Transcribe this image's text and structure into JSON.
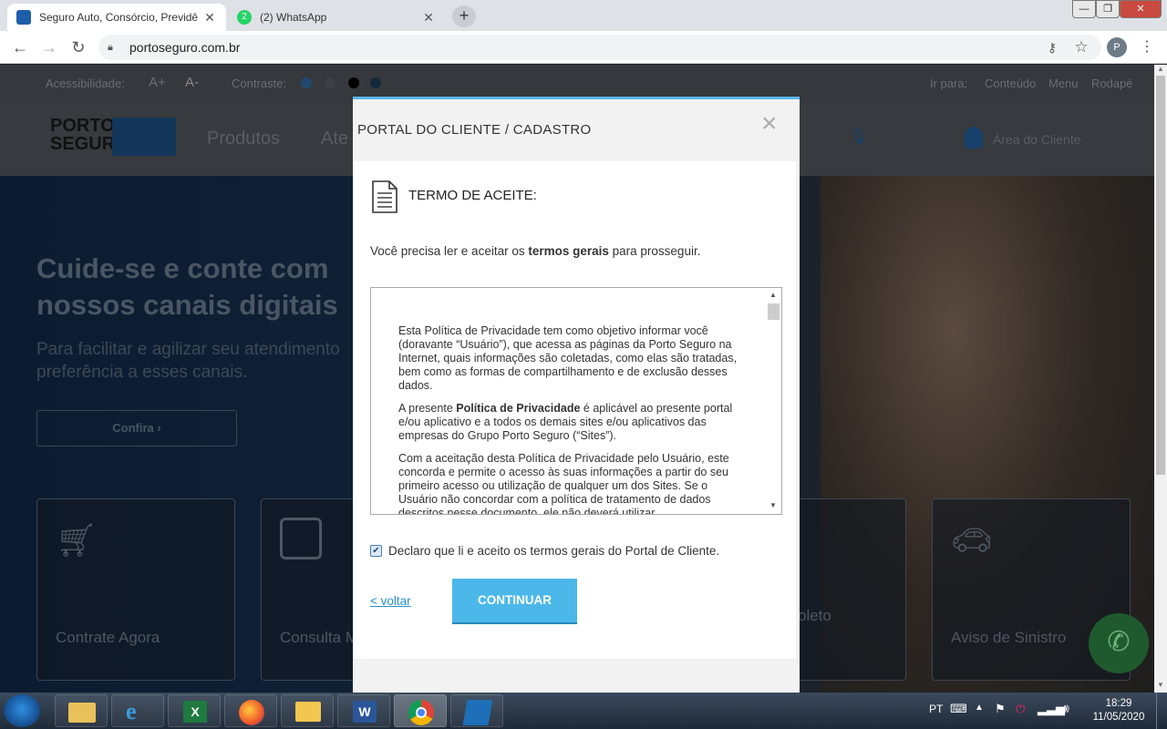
{
  "browser": {
    "tabs": [
      {
        "title": "Seguro Auto, Consórcio, Previdê",
        "favicon": "porto-seguro-favicon",
        "active": true
      },
      {
        "title": "(2) WhatsApp",
        "favicon": "whatsapp-favicon",
        "active": false
      }
    ],
    "url": "portoseguro.com.br",
    "profile_initial": "P"
  },
  "site": {
    "accessibility": {
      "label": "Acessibilidade:",
      "increase": "A+",
      "decrease": "A-",
      "contrast_label": "Contraste:",
      "jump_label": "Ir para:",
      "links": [
        "Conteúdo",
        "Menu",
        "Rodapé"
      ]
    },
    "logo_line1": "PORTO",
    "logo_line2": "SEGURO",
    "nav": [
      "Produtos",
      "Ate"
    ],
    "client_area": "Área do Cliente",
    "hero": {
      "title_line1": "Cuide-se e conte com",
      "title_line2": "nossos canais digitais",
      "sub_line1": "Para facilitar e agilizar seu atendimento",
      "sub_line2": "preferência a esses canais.",
      "cta": "Confira ›"
    },
    "cards": [
      "Contrate Agora",
      "Consulta M",
      "oleto",
      "Aviso de Sinistro"
    ]
  },
  "modal": {
    "title": "PORTAL DO CLIENTE / CADASTRO",
    "close": "×",
    "section_title": "TERMO DE ACEITE:",
    "intro_pre": "Você precisa ler e aceitar os ",
    "intro_bold": "termos gerais",
    "intro_post": " para prosseguir.",
    "terms": {
      "p1": "Esta Política de Privacidade tem como objetivo informar você (doravante “Usuário”), que acessa as páginas da Porto Seguro na Internet, quais informações são coletadas, como elas são tratadas, bem como as formas de compartilhamento e de exclusão desses dados.",
      "p2_pre": "A presente ",
      "p2_bold": "Política de Privacidade",
      "p2_post": " é aplicável ao presente portal e/ou aplicativo e a todos os demais sites e/ou aplicativos das empresas do Grupo Porto Seguro (“Sites”).",
      "p3": "Com a aceitação desta Política de Privacidade pelo Usuário, este concorda e permite o acesso às suas informações a partir do seu primeiro acesso ou utilização de qualquer um dos Sites. Se o Usuário não concordar com a política de tratamento de dados descritos nesse documento, ele não deverá utilizar"
    },
    "agree_label": "Declaro que li e aceito os termos gerais do Portal de Cliente.",
    "agree_checked": true,
    "back": "< voltar",
    "continue": "CONTINUAR"
  },
  "taskbar": {
    "apps": [
      "file-explorer-icon",
      "internet-explorer-icon",
      "excel-icon",
      "firefox-icon",
      "outlook-icon",
      "word-icon",
      "chrome-icon",
      "app-icon"
    ],
    "lang": "PT",
    "time": "18:29",
    "date": "11/05/2020"
  }
}
